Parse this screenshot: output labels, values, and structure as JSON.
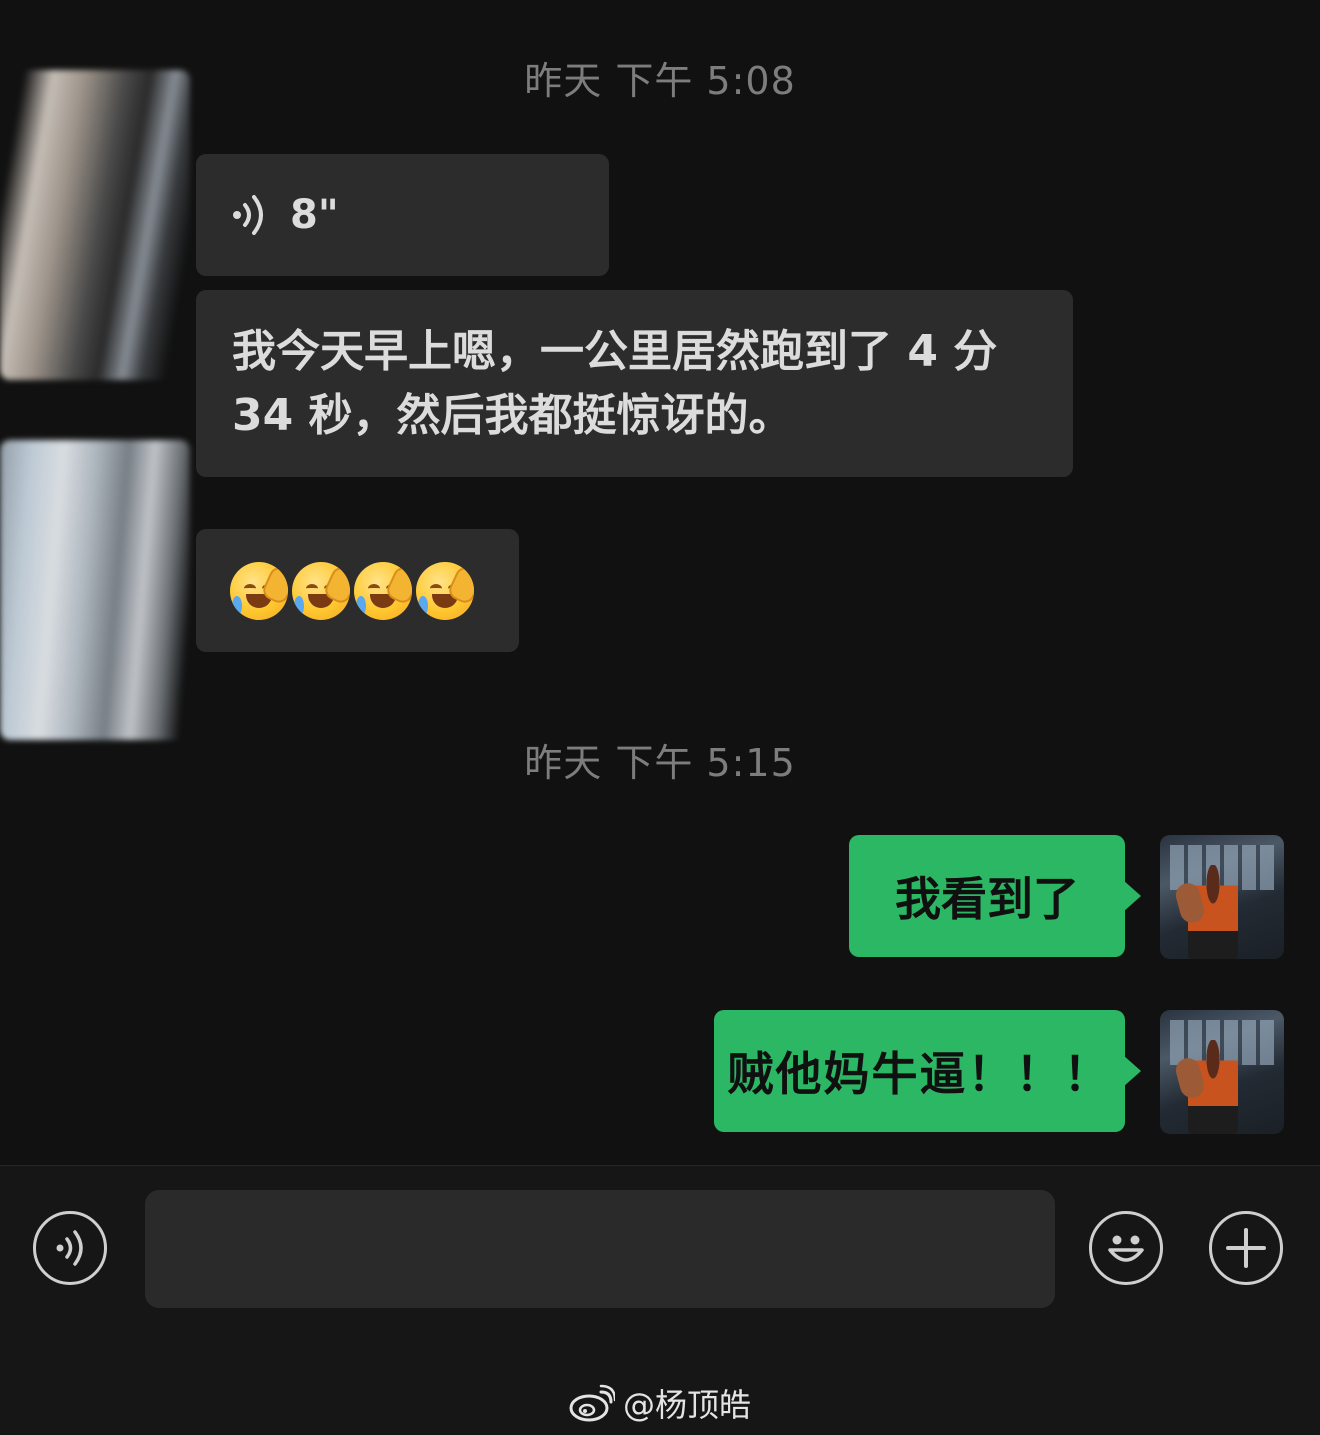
{
  "timestamps": [
    "昨天 下午 5:08",
    "昨天 下午 5:15"
  ],
  "voice_message": {
    "duration": "8\""
  },
  "text_message": "我今天早上嗯，一公里居然跑到了 4 分 34 秒，然后我都挺惊讶的。",
  "emoji_message": {
    "emoji_name": "face-with-hand-over-mouth-crying",
    "count": 4
  },
  "sent_messages": [
    "我看到了",
    "贼他妈牛逼！！！"
  ],
  "colors": {
    "background": "#111111",
    "received_bubble": "#2c2c2c",
    "sent_bubble": "#2bb764",
    "timestamp": "#7d7d7d"
  },
  "input_bar": {
    "voice_icon": "voice-icon",
    "emoji_icon": "smiley-icon",
    "plus_icon": "plus-icon",
    "value": ""
  },
  "watermark": "@杨顶皓"
}
